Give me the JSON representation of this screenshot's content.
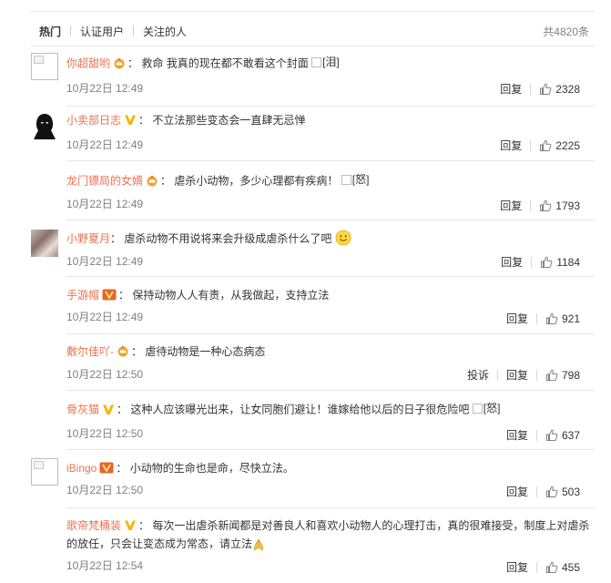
{
  "tabs": {
    "hot": "热门",
    "verified": "认证用户",
    "following": "关注的人",
    "total": "共4820条"
  },
  "labels": {
    "reply": "回复",
    "report": "投诉"
  },
  "colors": {
    "username": "#eb7350",
    "crown": "#f0a32e",
    "vip_yellow": "#f7b500",
    "vip_red": "#e8642b"
  },
  "comments": [
    {
      "user": "你超甜哟",
      "badge": "crown-icon",
      "text": "救命 我真的现在都不敢看这个封面",
      "emoticon": "[泪]",
      "time": "10月22日 12:49",
      "likes": "2328"
    },
    {
      "user": "小卖部日志",
      "badge": "verified-yellow-icon",
      "text": "不立法那些变态会一直肆无忌惮",
      "time": "10月22日 12:49",
      "likes": "2225"
    },
    {
      "user": "龙门镖局的女婿",
      "badge": "crown-icon",
      "text": "虐杀小动物，多少心理都有疾病！",
      "emoticon": "[怒]",
      "time": "10月22日 12:49",
      "likes": "1793"
    },
    {
      "user": "小野夏月",
      "text": "虐杀动物不用说将来会升级成虐杀什么了吧",
      "emoticon_icon": "smile-emoji-icon",
      "time": "10月22日 12:49",
      "likes": "1184"
    },
    {
      "user": "手游帽",
      "badge": "vip-red-icon",
      "text": "保持动物人人有责，从我做起，支持立法",
      "time": "10月22日 12:49",
      "likes": "921"
    },
    {
      "user": "敷尔佳吖-",
      "badge": "crown-icon",
      "text": "虐待动物是一种心态病态",
      "time": "10月22日 12:50",
      "likes": "798"
    },
    {
      "user": "骨灰猫",
      "badge": "verified-yellow-icon",
      "text": "这种人应该曝光出来，让女同胞们避让！谁嫁给他以后的日子很危险吧",
      "emoticon": "[怒]",
      "time": "10月22日 12:50",
      "likes": "637"
    },
    {
      "user": "iBingo",
      "badge": "vip-red-icon",
      "text": "小动物的生命也是命，尽快立法。",
      "time": "10月22日 12:50",
      "likes": "503"
    },
    {
      "user": "歌帝梵桶装",
      "badge": "verified-yellow-icon",
      "text": "每次一出虐杀新闻都是对善良人和喜欢小动物人的心理打击，真的很难接受，制度上对虐杀",
      "text_line2": "的放任，只会让变态成为常态，请立法",
      "emoticon_icon": "pray-emoji-icon",
      "time": "10月22日 12:54",
      "likes": "455"
    }
  ]
}
